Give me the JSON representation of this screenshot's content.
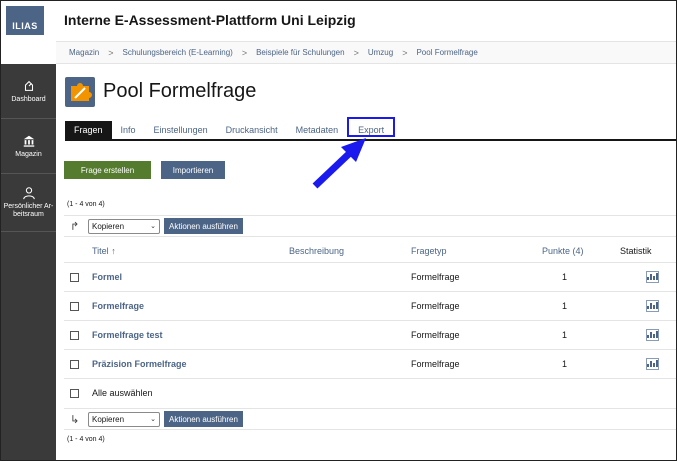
{
  "header": {
    "logo_text": "ILIAS",
    "title": "Interne E-Assessment-Plattform Uni Leipzig"
  },
  "breadcrumb": {
    "items": [
      "Magazin",
      "Schulungsbereich (E-Learning)",
      "Beispiele für Schulungen",
      "Umzug",
      "Pool Formelfrage"
    ],
    "separator": ">"
  },
  "sidebar": {
    "items": [
      {
        "label": "Dashboard",
        "icon": "dashboard-icon"
      },
      {
        "label": "Magazin",
        "icon": "bank-icon"
      },
      {
        "label": "Persönlicher Ar-beitsraum",
        "icon": "person-icon"
      }
    ]
  },
  "page": {
    "title": "Pool Formelfrage",
    "icon": "puzzle-icon"
  },
  "tabs": [
    "Fragen",
    "Info",
    "Einstellungen",
    "Druckansicht",
    "Metadaten",
    "Export"
  ],
  "toolbar": {
    "create_label": "Frage erstellen",
    "import_label": "Importieren"
  },
  "pagination": {
    "count_top": "(1 - 4 von 4)",
    "count_bottom": "(1 - 4 von 4)"
  },
  "actions": {
    "select_value": "Kopieren",
    "execute_label": "Aktionen ausführen"
  },
  "table": {
    "headers": {
      "title": "Titel",
      "sort_indicator": "↑",
      "description": "Beschreibung",
      "type": "Fragetyp",
      "points": "Punkte (4)",
      "stats": "Statistik"
    },
    "rows": [
      {
        "title": "Formel",
        "type": "Formelfrage",
        "points": "1"
      },
      {
        "title": "Formelfrage",
        "type": "Formelfrage",
        "points": "1"
      },
      {
        "title": "Formelfrage test",
        "type": "Formelfrage",
        "points": "1"
      },
      {
        "title": "Präzision Formelfrage",
        "type": "Formelfrage",
        "points": "1"
      }
    ],
    "select_all_label": "Alle auswählen"
  },
  "colors": {
    "brand_blue": "#4c6586",
    "create_green": "#557b2e",
    "annotation_blue": "#1a1aee",
    "sidebar_dark": "#3a3a3a"
  }
}
